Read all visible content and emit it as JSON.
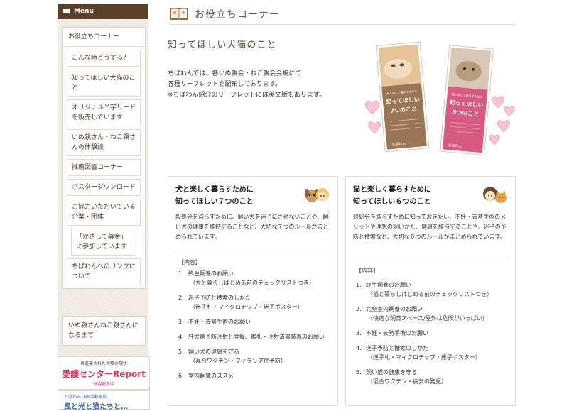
{
  "sidebar": {
    "menu_title": "Menu",
    "top_item": "お役立ちコーナー",
    "items": [
      "こんな時どうする？",
      "知ってほしい犬猫のこと",
      "オリジナルＹ字リードを販売しています",
      "いぬ親さん・ねこ親さんの体験談",
      "推薦図書コーナー",
      "ポスターダウンロード",
      "ご協力いただいている企業・団体"
    ],
    "nested_item": "「かざして募金」に参加しています",
    "item_after_nested": "ちばわんへのリンクについて",
    "bottom_item": "いぬ親さんねこ親さんになるまで",
    "banner": {
      "line1": "一旦遺棄された犬猫の現状一",
      "line2": "愛護センターReport",
      "line3": "毎週更新中"
    },
    "banner2": {
      "line1": "ちばわんTNR活動報告",
      "line2": "風と光と猫たちと…"
    }
  },
  "header": {
    "page_title": "お役立ちコーナー"
  },
  "main": {
    "section_title": "知ってほしい犬猫のこと",
    "intro": [
      "ちばわんでは、各いぬ親会・ねこ親会会場にて",
      "各種リーフレットを配布しております。",
      "※ちばわん紹介のリーフレットには英文版もあります。"
    ],
    "leaflets": [
      {
        "small": "犬と楽しく暮らすために",
        "title1": "知ってほしい",
        "title2": "7つのこと",
        "brand": "ちばわん"
      },
      {
        "small": "猫と楽しく暮らすために",
        "title1": "知ってほしい",
        "title2": "6つのこと",
        "brand": "ちばわん"
      }
    ]
  },
  "cards": [
    {
      "title_line1": "犬と楽しく暮らすために",
      "title_line2": "知ってほしい７つのこと",
      "desc": "殺処分を減らすために、飼い犬を迷子にさせないことや、飼い犬の健康を維持することなど、大切な７つのルールがまとめられています。",
      "contents_label": "【内容】",
      "items": [
        {
          "num": "1.",
          "text": "終生飼養のお願い",
          "sub": "（犬と暮らしはじめる前のチェックリストつき）"
        },
        {
          "num": "2.",
          "text": "迷子予防と捜索のしかた",
          "sub": "（迷子札・マイクロチップ・迷子ポスター）"
        },
        {
          "num": "3.",
          "text": "不妊・去勢手術のお願い",
          "sub": ""
        },
        {
          "num": "4.",
          "text": "狂犬病予防注射と登録、鑑札・注射済票装着のお願い",
          "sub": ""
        },
        {
          "num": "5.",
          "text": "飼い犬の健康を守る",
          "sub": "（混合ワクチン・フィラリア症予防）"
        },
        {
          "num": "6.",
          "text": "室内飼育のススメ",
          "sub": ""
        }
      ]
    },
    {
      "title_line1": "猫と楽しく暮らすために",
      "title_line2": "知ってほしい６つのこと",
      "desc": "殺処分を減らすために知っておきたい、不妊・去勢手術のメリットや理想の飼いかた、健康を維持することや、迷子の予防と捜索など、大切な６つのルールがまとめられています。",
      "contents_label": "【内容】",
      "items": [
        {
          "num": "1.",
          "text": "終生飼養のお願い",
          "sub": "（猫と暮らしはじめる前のチェックリストつき）"
        },
        {
          "num": "2.",
          "text": "完全室内飼養のお願い",
          "sub": "（快適な飼育スペース/屋外は危険がいっぱい）"
        },
        {
          "num": "3.",
          "text": "不妊・去勢手術のお願い",
          "sub": ""
        },
        {
          "num": "4.",
          "text": "迷子予防と捜索のしかた",
          "sub": "（迷子札・マイクロチップ・迷子ポスター）"
        },
        {
          "num": "5.",
          "text": "飼い猫の健康を守る",
          "sub": "（混合ワクチン・病気の発見）"
        }
      ]
    }
  ]
}
